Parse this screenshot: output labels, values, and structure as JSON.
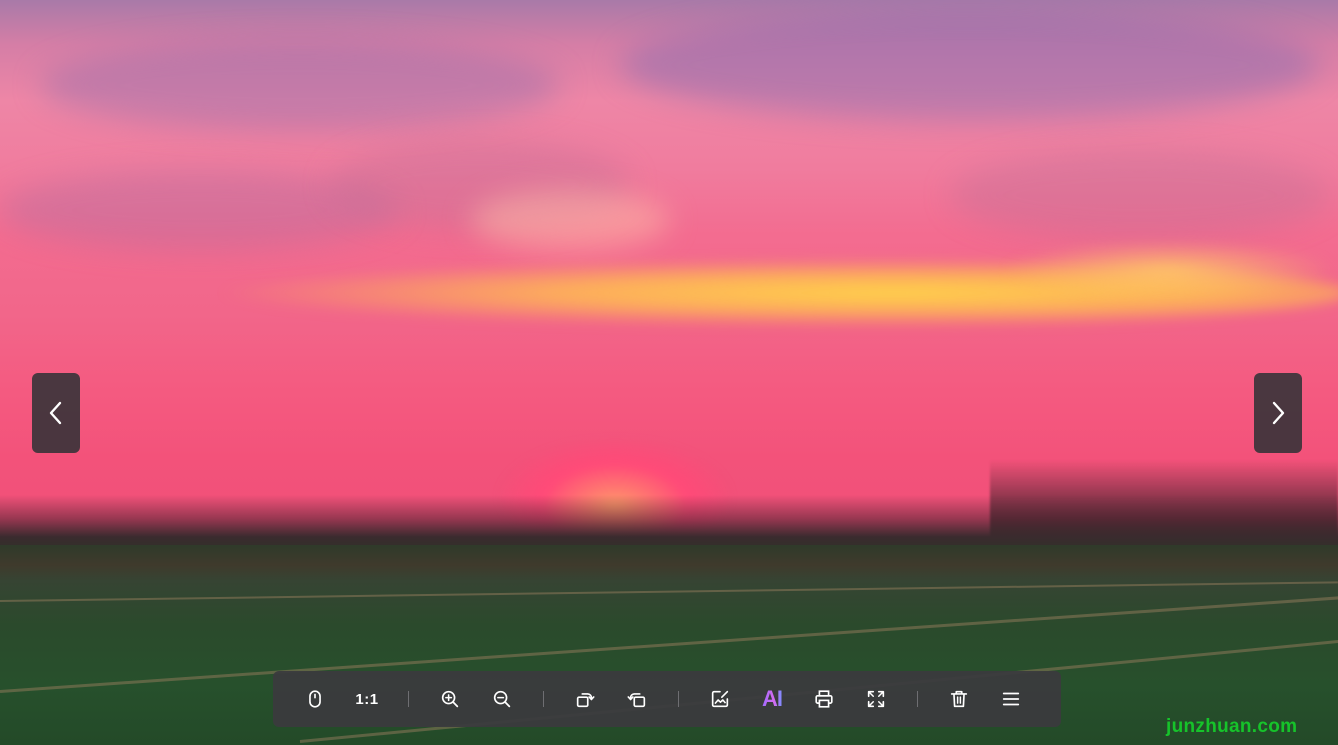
{
  "viewer": {
    "nav": {
      "prev_icon": "chevron-left-icon",
      "next_icon": "chevron-right-icon"
    },
    "toolbar": {
      "ratio_label": "1:1",
      "ai_label": "AI",
      "icons": [
        "mouse-icon",
        "actual-size-icon",
        "zoom-in-icon",
        "zoom-out-icon",
        "rotate-right-icon",
        "rotate-left-icon",
        "edit-image-icon",
        "ai-icon",
        "print-icon",
        "fullscreen-icon",
        "delete-icon",
        "menu-icon"
      ]
    },
    "watermark": "junzhuan.com",
    "colors": {
      "toolbar_bg": "#3a3a3e",
      "ai_gradient_start": "#a06bff",
      "ai_gradient_end": "#7a8dff",
      "watermark": "#16c32a"
    }
  }
}
